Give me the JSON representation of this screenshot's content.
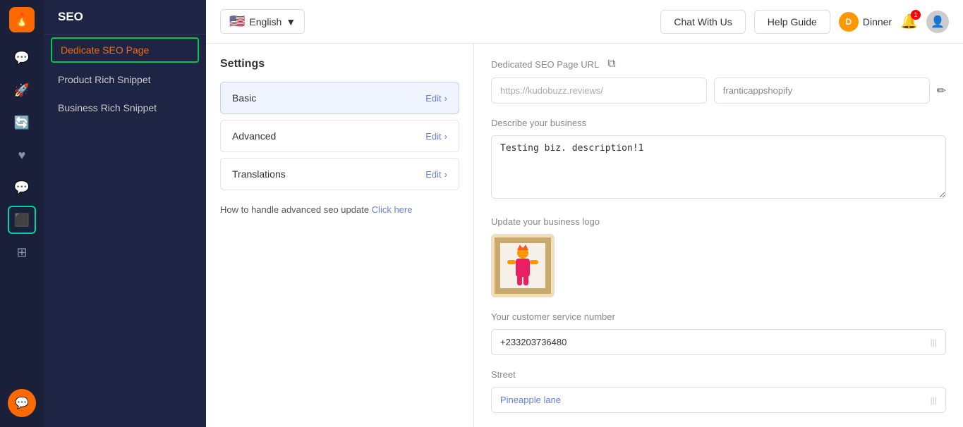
{
  "app": {
    "title": "SEO"
  },
  "topbar": {
    "language": "English",
    "chat_btn": "Chat With Us",
    "help_btn": "Help Guide",
    "user_name": "Dinner",
    "notification_count": "1"
  },
  "sidebar": {
    "items": [
      {
        "id": "dedicate-seo",
        "label": "Dedicate SEO Page",
        "active": true
      },
      {
        "id": "product-rich",
        "label": "Product Rich Snippet",
        "active": false
      },
      {
        "id": "business-rich",
        "label": "Business Rich Snippet",
        "active": false
      }
    ]
  },
  "settings": {
    "title": "Settings",
    "items": [
      {
        "id": "basic",
        "label": "Basic",
        "edit": "Edit",
        "active": true
      },
      {
        "id": "advanced",
        "label": "Advanced",
        "edit": "Edit",
        "active": false
      },
      {
        "id": "translations",
        "label": "Translations",
        "edit": "Edit",
        "active": false
      }
    ],
    "seo_hint_text": "How to handle advanced seo update",
    "seo_hint_link": "Click here"
  },
  "form": {
    "dedicated_url_label": "Dedicated SEO Page URL",
    "url_base": "https://kudobuzz.reviews/",
    "url_suffix": "franticappshopify",
    "business_desc_label": "Describe your business",
    "business_desc_value": "Testing biz. description!1",
    "logo_label": "Update your business logo",
    "customer_service_label": "Your customer service number",
    "customer_service_value": "+233203736480",
    "street_label": "Street",
    "street_value": "Pineapple lane"
  },
  "icons": {
    "logo": "🔥",
    "chat_bubble": "💬",
    "analytics": "📊",
    "layers": "⊞",
    "bell": "🔔",
    "user": "👤",
    "check": "✓",
    "chevron_right": "›",
    "pencil": "✏",
    "copy": "⧉",
    "bars": "|||"
  },
  "colors": {
    "sidebar_bg": "#1e2444",
    "active_nav": "#00c853",
    "accent_orange": "#ff6a00",
    "accent_blue": "#667eea",
    "text_light": "#8892b0"
  }
}
